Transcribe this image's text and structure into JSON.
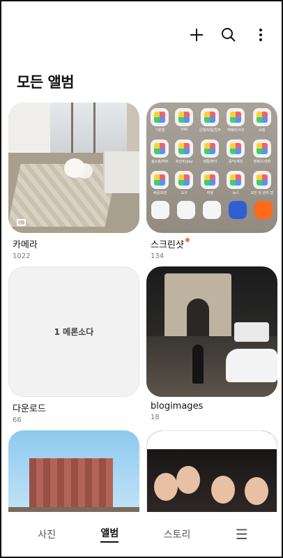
{
  "page_title": "모든 앨범",
  "top_actions": {
    "add_icon": "plus-icon",
    "search_icon": "search-icon",
    "more_icon": "more-vertical-icon"
  },
  "albums": [
    {
      "name": "카메라",
      "count": "1022",
      "new_badge": false
    },
    {
      "name": "스크린샷",
      "count": "134",
      "new_badge": true,
      "badge_color": "#f07a36"
    },
    {
      "name": "다운로드",
      "count": "66",
      "placeholder": "1 메론소다"
    },
    {
      "name": "blogimages",
      "count": "18"
    },
    {
      "name": "",
      "count": ""
    },
    {
      "name": "",
      "count": ""
    }
  ],
  "homescreen_apps": [
    "기본앱",
    "SNS",
    "은행/보험/업무",
    "카메라/사진",
    "쇼핑",
    "홈쇼핑/마트",
    "포인트/pay",
    "생활/편의",
    "음악/게임",
    "영화/드라마",
    "세금/보안",
    "도구",
    "여행",
    "뉴스",
    "보안 및 관리 앱"
  ],
  "bottom_nav": [
    {
      "label": "사진",
      "active": false
    },
    {
      "label": "앨범",
      "active": true
    },
    {
      "label": "스토리",
      "active": false
    },
    {
      "label": "☰",
      "active": false
    }
  ]
}
